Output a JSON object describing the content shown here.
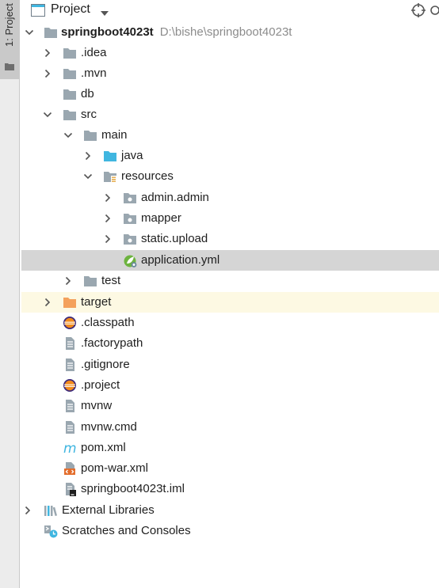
{
  "side": {
    "tab_label": "1: Project"
  },
  "header": {
    "title": "Project"
  },
  "tree": {
    "root": {
      "label": "springboot4023t",
      "path": "D:\\bishe\\springboot4023t"
    },
    "idea": ".idea",
    "mvn": ".mvn",
    "db": "db",
    "src": "src",
    "main": "main",
    "java": "java",
    "resources": "resources",
    "admin_admin": "admin.admin",
    "mapper": "mapper",
    "static_upload": "static.upload",
    "application_yml": "application.yml",
    "test": "test",
    "target": "target",
    "classpath": ".classpath",
    "factorypath": ".factorypath",
    "gitignore": ".gitignore",
    "project": ".project",
    "mvnw": "mvnw",
    "mvnw_cmd": "mvnw.cmd",
    "pom_xml": "pom.xml",
    "pom_war_xml": "pom-war.xml",
    "iml": "springboot4023t.iml",
    "external_libraries": "External Libraries",
    "scratches": "Scratches and Consoles"
  },
  "colors": {
    "folder": "#9aa7b0",
    "source_folder": "#40b6e0",
    "excluded_folder": "#f4a15c",
    "selection": "#d5d5d5",
    "excluded_row": "#fdf9e3"
  }
}
